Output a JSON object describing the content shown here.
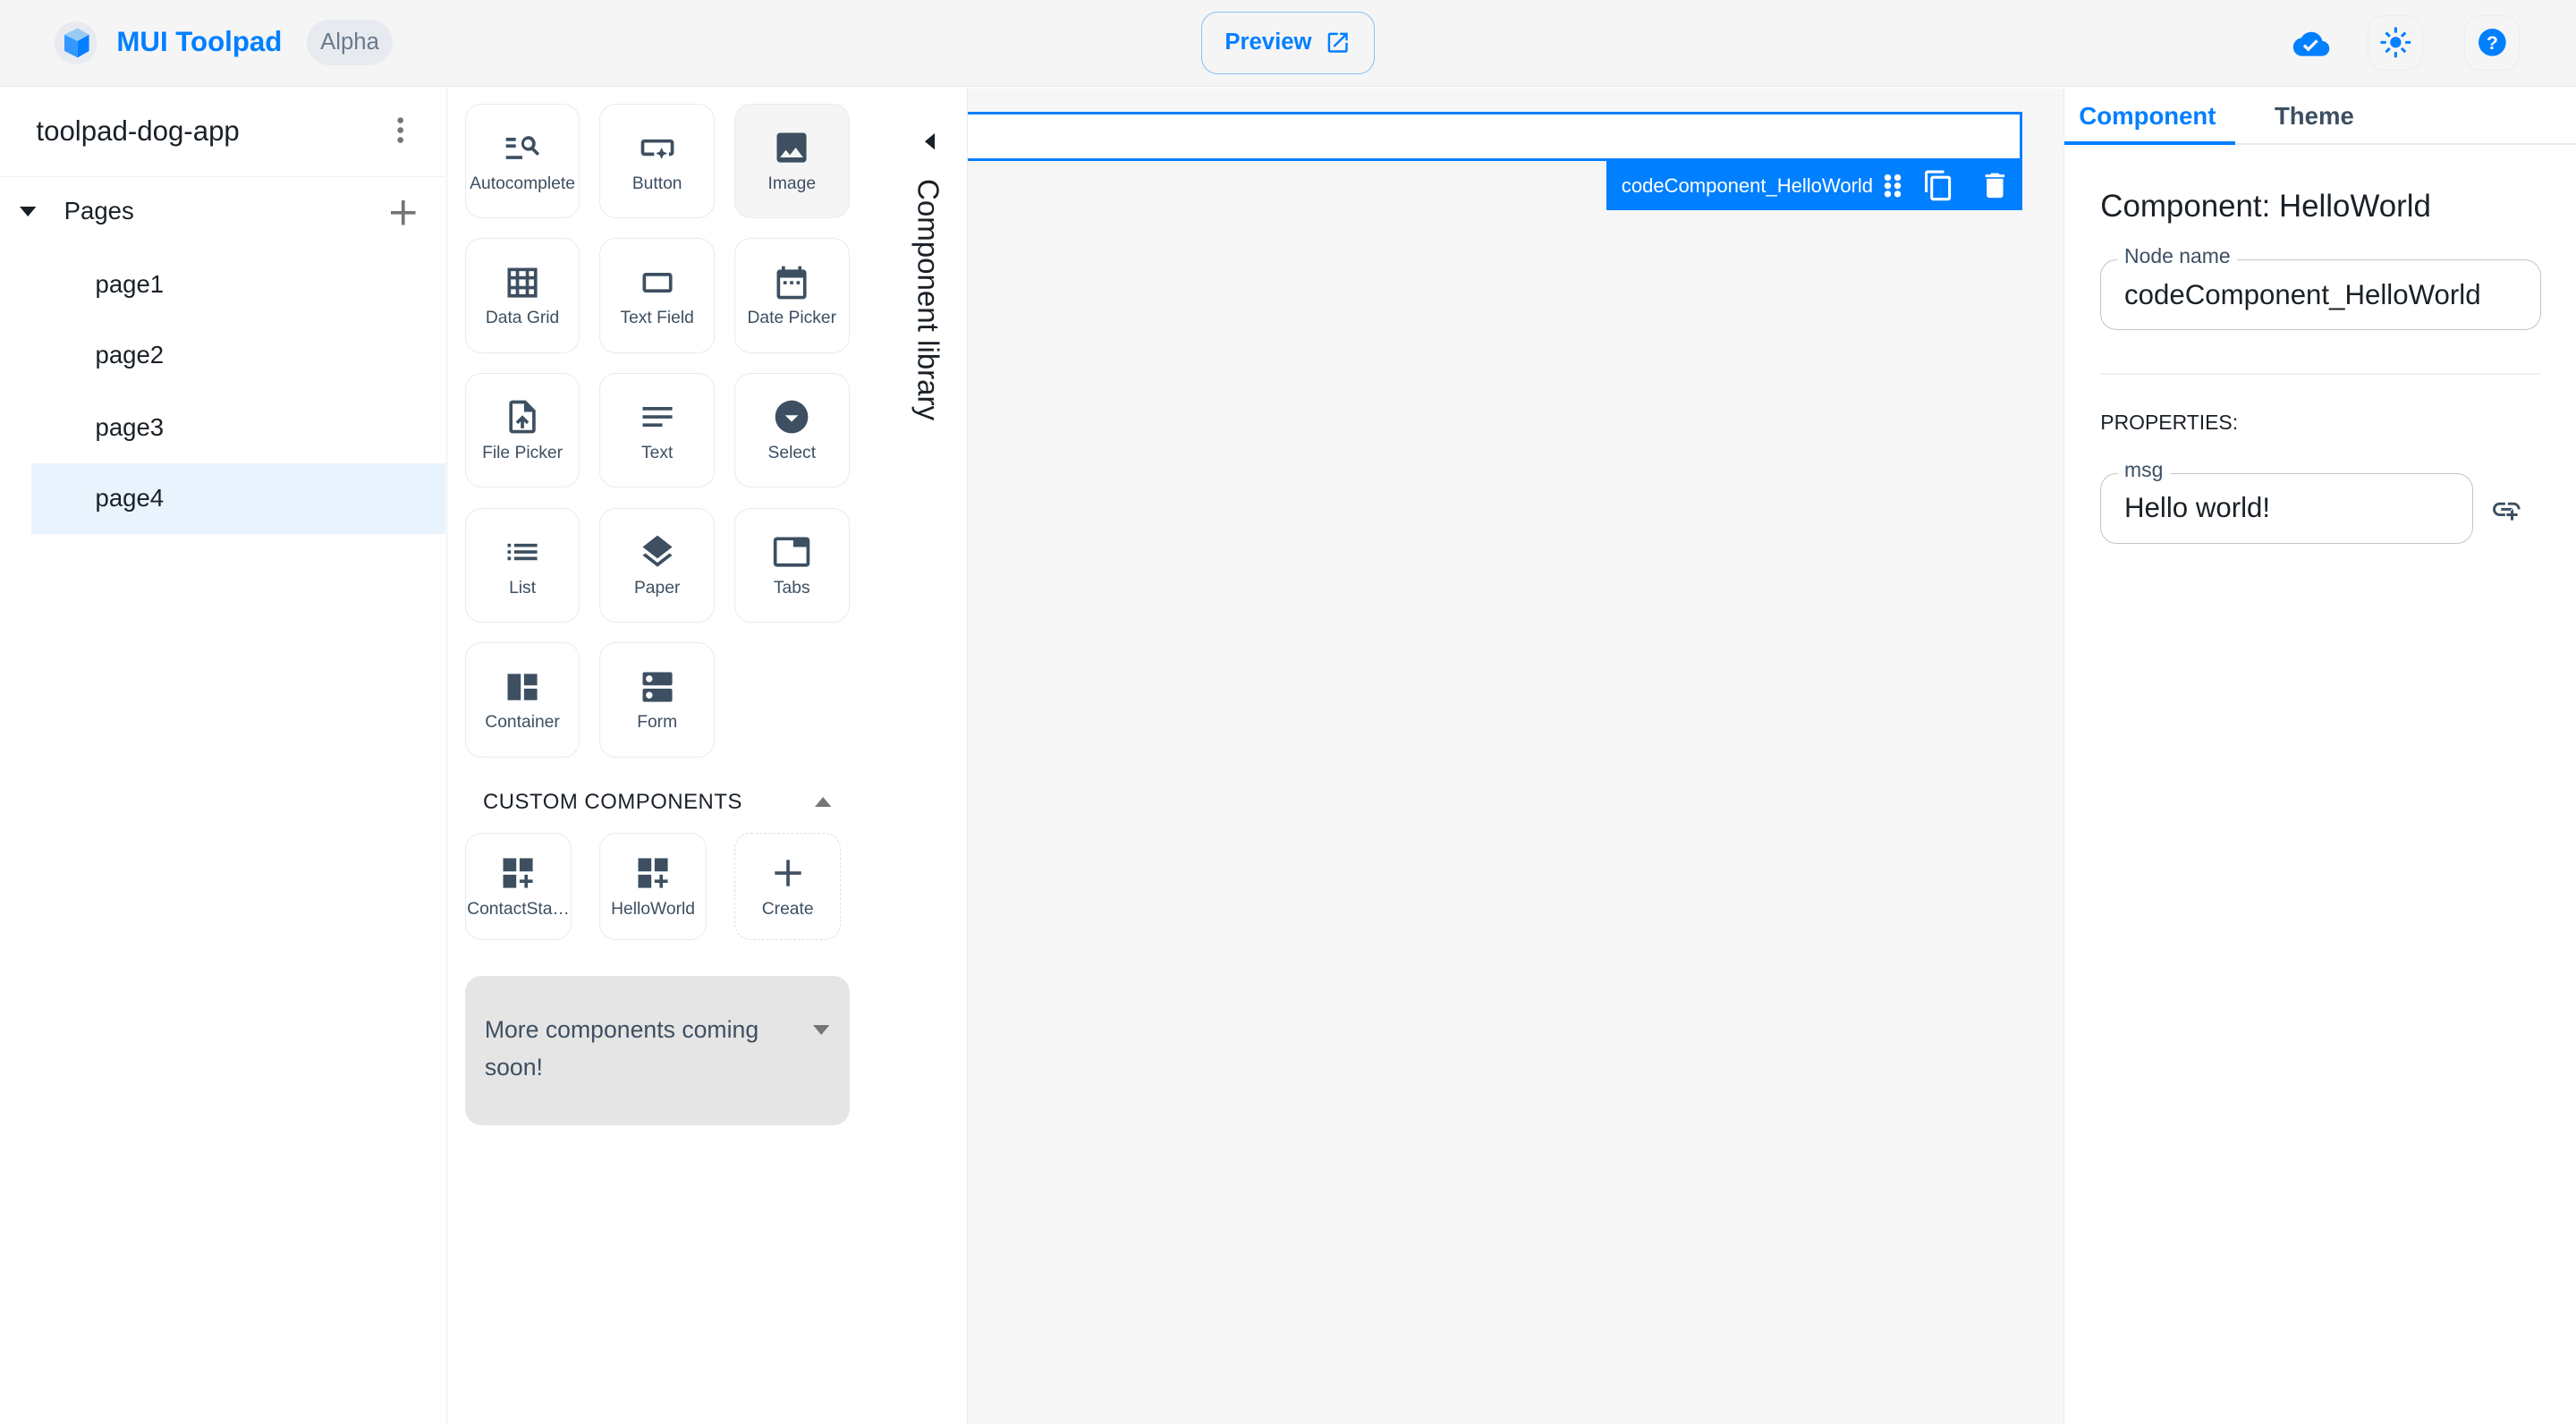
{
  "header": {
    "brand": "MUI Toolpad",
    "badge": "Alpha",
    "preview_label": "Preview",
    "icons": [
      "cloud-done-icon",
      "light-mode-icon",
      "help-icon"
    ],
    "accent": "#007fff"
  },
  "sidebar": {
    "app_name": "toolpad-dog-app",
    "pages_label": "Pages",
    "pages": [
      {
        "label": "page1"
      },
      {
        "label": "page2"
      },
      {
        "label": "page3"
      },
      {
        "label": "page4",
        "selected": true
      }
    ]
  },
  "library": {
    "title": "Component library",
    "components": [
      {
        "label": "Autocomplete",
        "icon": "autocomplete-icon"
      },
      {
        "label": "Button",
        "icon": "smart-button-icon"
      },
      {
        "label": "Image",
        "icon": "image-icon"
      },
      {
        "label": "Data Grid",
        "icon": "grid-icon"
      },
      {
        "label": "Text Field",
        "icon": "crop-rectangle-icon"
      },
      {
        "label": "Date Picker",
        "icon": "calendar-icon"
      },
      {
        "label": "File Picker",
        "icon": "upload-file-icon"
      },
      {
        "label": "Text",
        "icon": "notes-icon"
      },
      {
        "label": "Select",
        "icon": "arrow-drop-down-circle-icon"
      },
      {
        "label": "List",
        "icon": "list-icon"
      },
      {
        "label": "Paper",
        "icon": "layers-icon"
      },
      {
        "label": "Tabs",
        "icon": "tab-icon"
      },
      {
        "label": "Container",
        "icon": "dashboard-icon"
      },
      {
        "label": "Form",
        "icon": "dns-icon"
      }
    ],
    "custom_title": "CUSTOM COMPONENTS",
    "custom": [
      {
        "label": "ContactSta…"
      },
      {
        "label": "HelloWorld"
      },
      {
        "label": "Create"
      }
    ],
    "more": "More components coming soon!"
  },
  "canvas": {
    "selected_node": "codeComponent_HelloWorld"
  },
  "inspector": {
    "tabs": [
      "Component",
      "Theme"
    ],
    "title": "Component: HelloWorld",
    "node_name_label": "Node name",
    "node_name": "codeComponent_HelloWorld",
    "properties_label": "PROPERTIES:",
    "props": [
      {
        "label": "msg",
        "value": "Hello world!"
      }
    ]
  }
}
